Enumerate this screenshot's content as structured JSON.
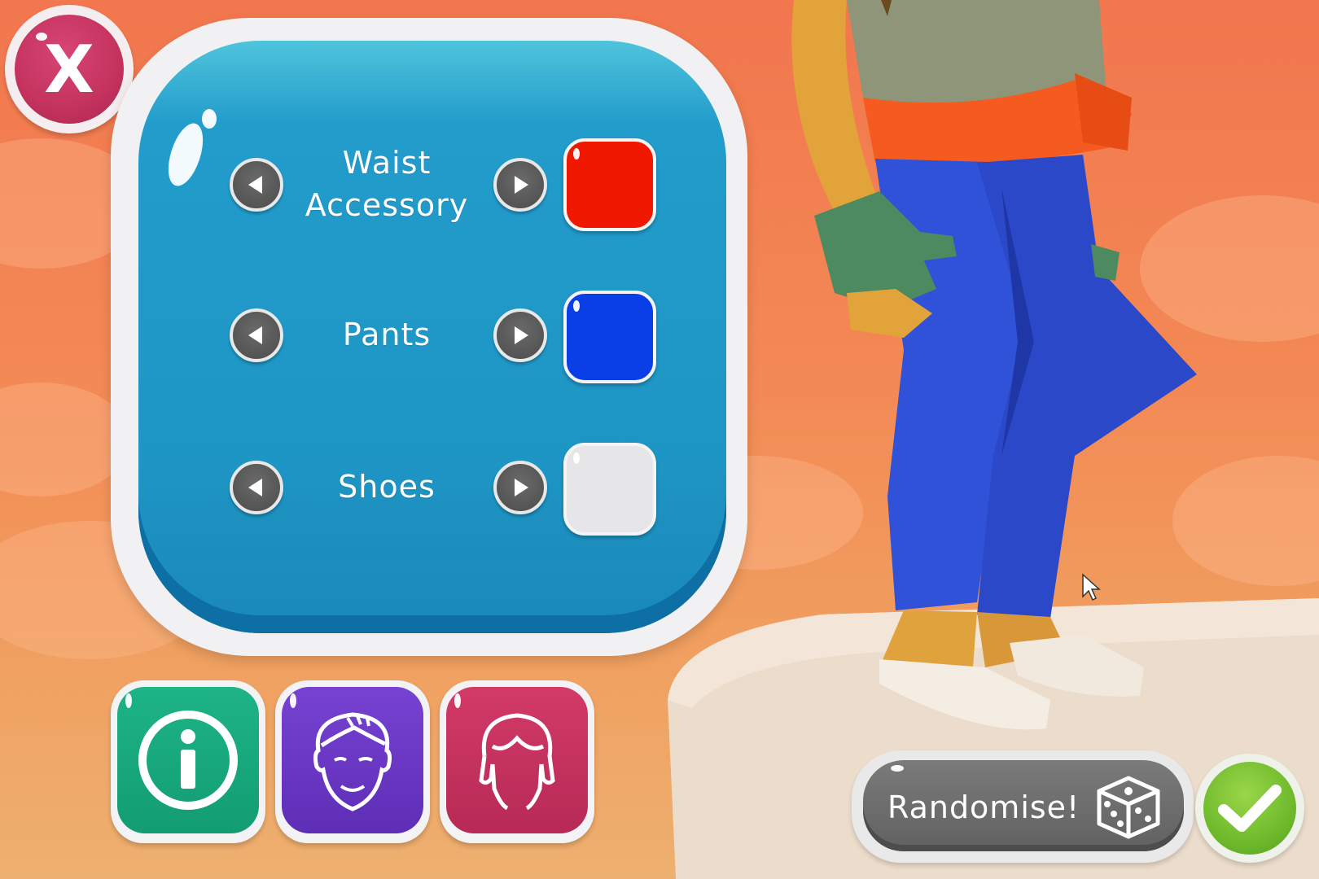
{
  "close_button": {
    "label": "X"
  },
  "outfit_rows": [
    {
      "label_line1": "Waist",
      "label_line2": "Accessory",
      "color": "#f01800"
    },
    {
      "label": "Pants",
      "color": "#0a3ee6"
    },
    {
      "label": "Shoes",
      "color": "#e6e6e8"
    }
  ],
  "tabs": [
    {
      "icon": "info-icon",
      "color": "#17a37a"
    },
    {
      "icon": "face-icon",
      "color": "#6a35c4"
    },
    {
      "icon": "hair-icon",
      "color": "#c8305e"
    }
  ],
  "randomise": {
    "label": "Randomise!",
    "icon": "dice-icon"
  },
  "confirm": {
    "icon": "check-icon",
    "color": "#6cb82a"
  },
  "colors": {
    "panel_blue": "#1e96c5",
    "arrow_gray": "#505050",
    "background_orange": "#f38a55"
  }
}
